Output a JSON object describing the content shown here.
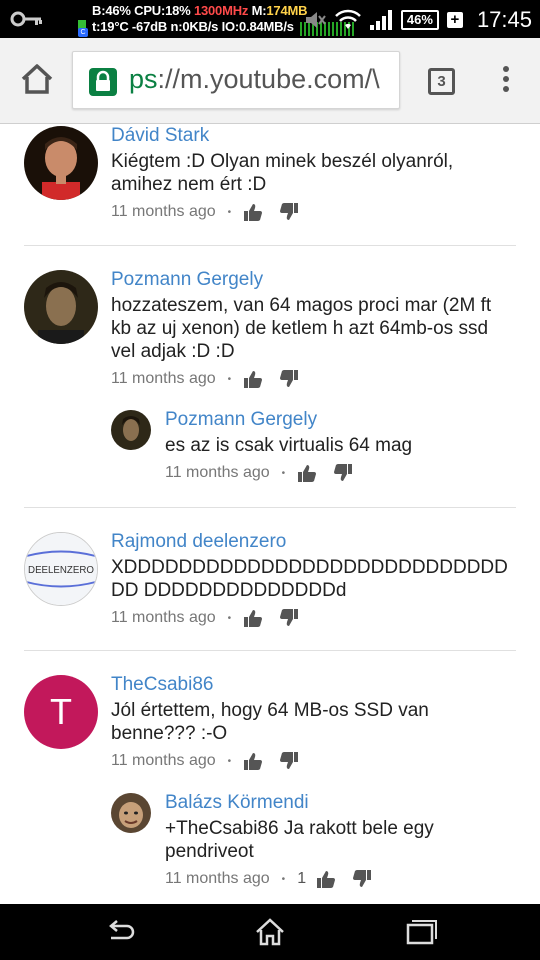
{
  "status_bar": {
    "stats_line1_a": "B:46% CPU:18% ",
    "stats_line1_hot": "1300MHz",
    "stats_line1_b": " M:",
    "stats_line1_mem": "174MB",
    "stats_line2": "t:19°C -67dB n:0KB/s IO:0.84MB/s",
    "battery": "46%",
    "time": "17:45"
  },
  "browser": {
    "url_scheme": "ps",
    "url_rest": "://m.youtube.com/\\",
    "tab_count": "3"
  },
  "comments": [
    {
      "author": "Dávid Stark",
      "text": "Kiégtem :D Olyan minek beszél olyanról, amihez nem ért :D",
      "time": "11 months ago",
      "likes": ""
    },
    {
      "author": "Pozmann Gergely",
      "text": "hozzateszem, van 64 magos proci mar (2M ft kb az uj xenon) de ketlem h azt 64mb-os ssd vel adjak :D :D",
      "time": "11 months ago",
      "likes": ""
    },
    {
      "author": "Pozmann Gergely",
      "text": "es az is csak virtualis 64 mag",
      "time": "11 months ago",
      "likes": ""
    },
    {
      "author": "Rajmond deelenzero",
      "text": "XDDDDDDDDDDDDDDDDDDDDDDDDDDDDDD DDDDDDDDDDDDDDd",
      "time": "11 months ago",
      "likes": "",
      "avatar_text": "DEELENZERO"
    },
    {
      "author": "TheCsabi86",
      "text": "Jól értettem, hogy 64 MB-os SSD van benne??? :-O",
      "time": "11 months ago",
      "likes": "",
      "avatar_text": "T"
    },
    {
      "author": "Balázs Körmendi",
      "text": "+TheCsabi86 Ja rakott bele egy pendriveot",
      "time": "11 months ago",
      "likes": "1"
    }
  ],
  "colors": {
    "author": "#4285c8",
    "avatar_t": "#c2185b",
    "secure_green": "#0b8043"
  }
}
